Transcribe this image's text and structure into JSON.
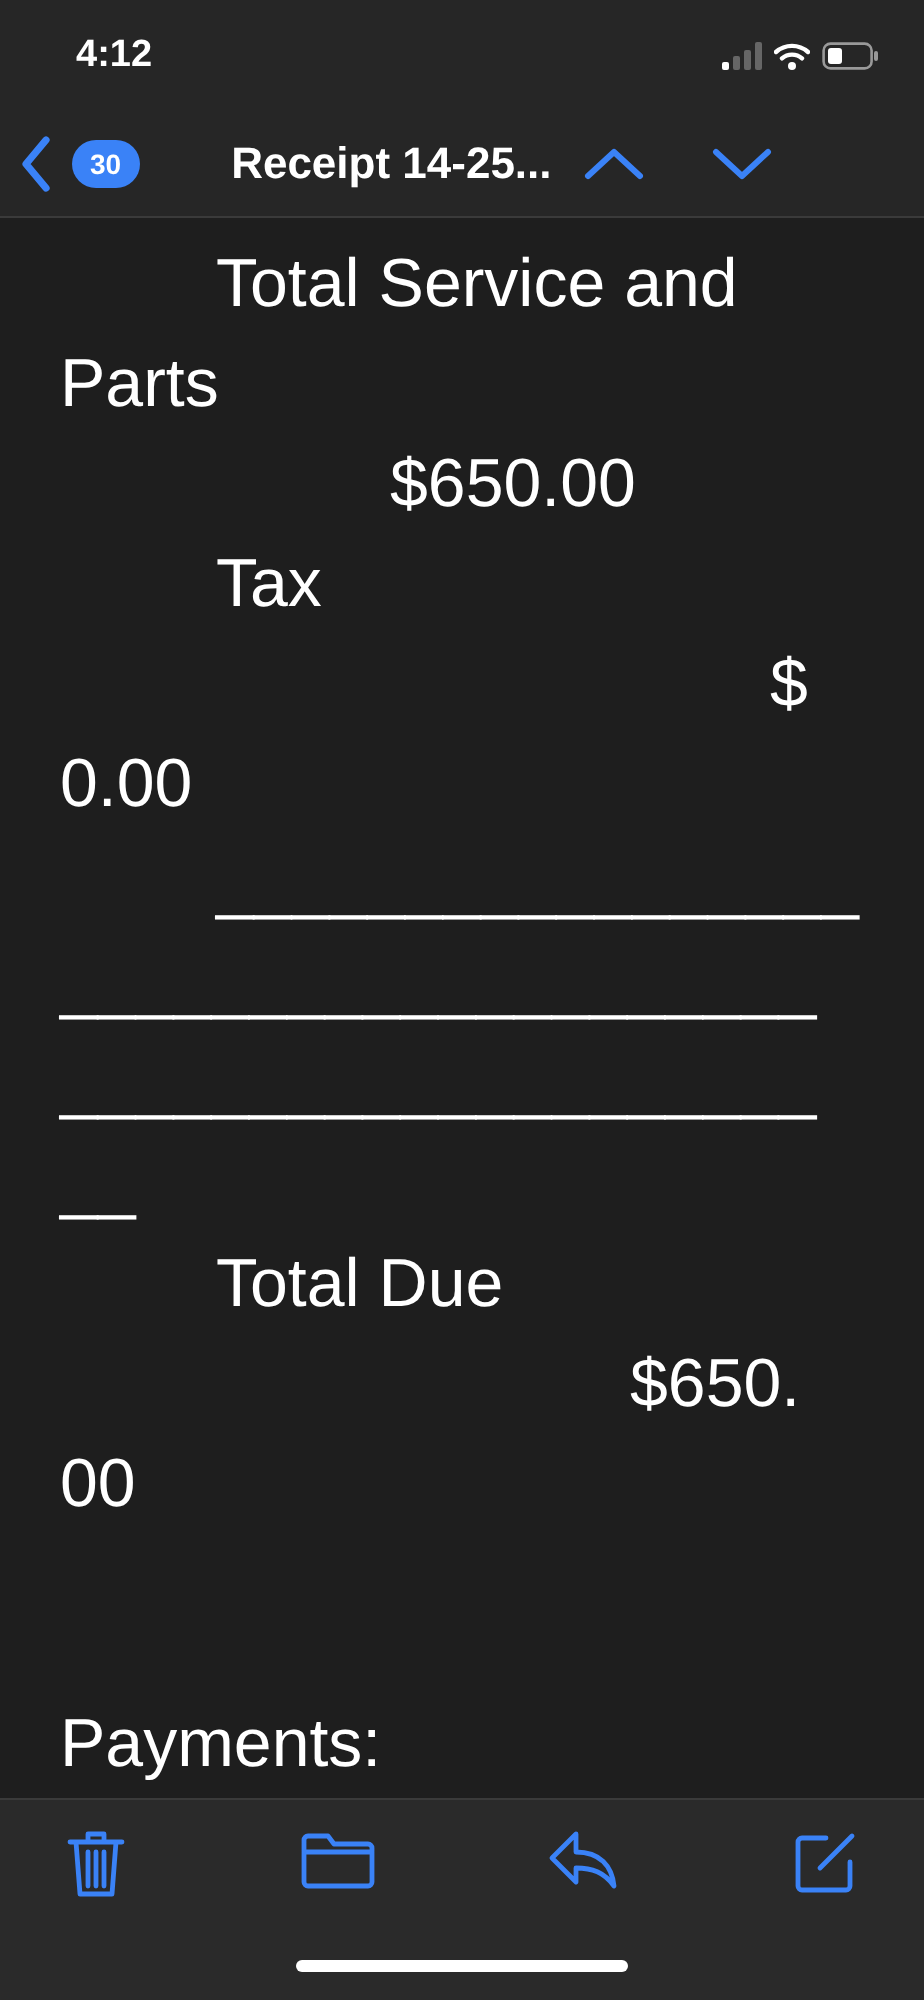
{
  "status_bar": {
    "time": "4:12"
  },
  "nav": {
    "unread_count": "30",
    "title": "Receipt 14-25..."
  },
  "body": {
    "lines": [
      {
        "text": "Total Service and",
        "kind": "tab1"
      },
      {
        "text": "Parts",
        "kind": "flush"
      },
      {
        "text": "$650.00",
        "kind": "tab2"
      },
      {
        "text": "Tax",
        "kind": "tab1"
      },
      {
        "text": "$",
        "kind": "tab4"
      },
      {
        "text": "0.00",
        "kind": "flush"
      },
      {
        "text": "_________________",
        "kind": "tab1"
      },
      {
        "text": "____________________",
        "kind": "flush"
      },
      {
        "text": "____________________",
        "kind": "flush"
      },
      {
        "text": "__",
        "kind": "flush"
      },
      {
        "text": "Total Due",
        "kind": "tab1"
      },
      {
        "text": "$650.",
        "kind": "tab3"
      },
      {
        "text": "00",
        "kind": "flush"
      },
      {
        "text": "Payments:",
        "kind": "gap"
      }
    ]
  }
}
